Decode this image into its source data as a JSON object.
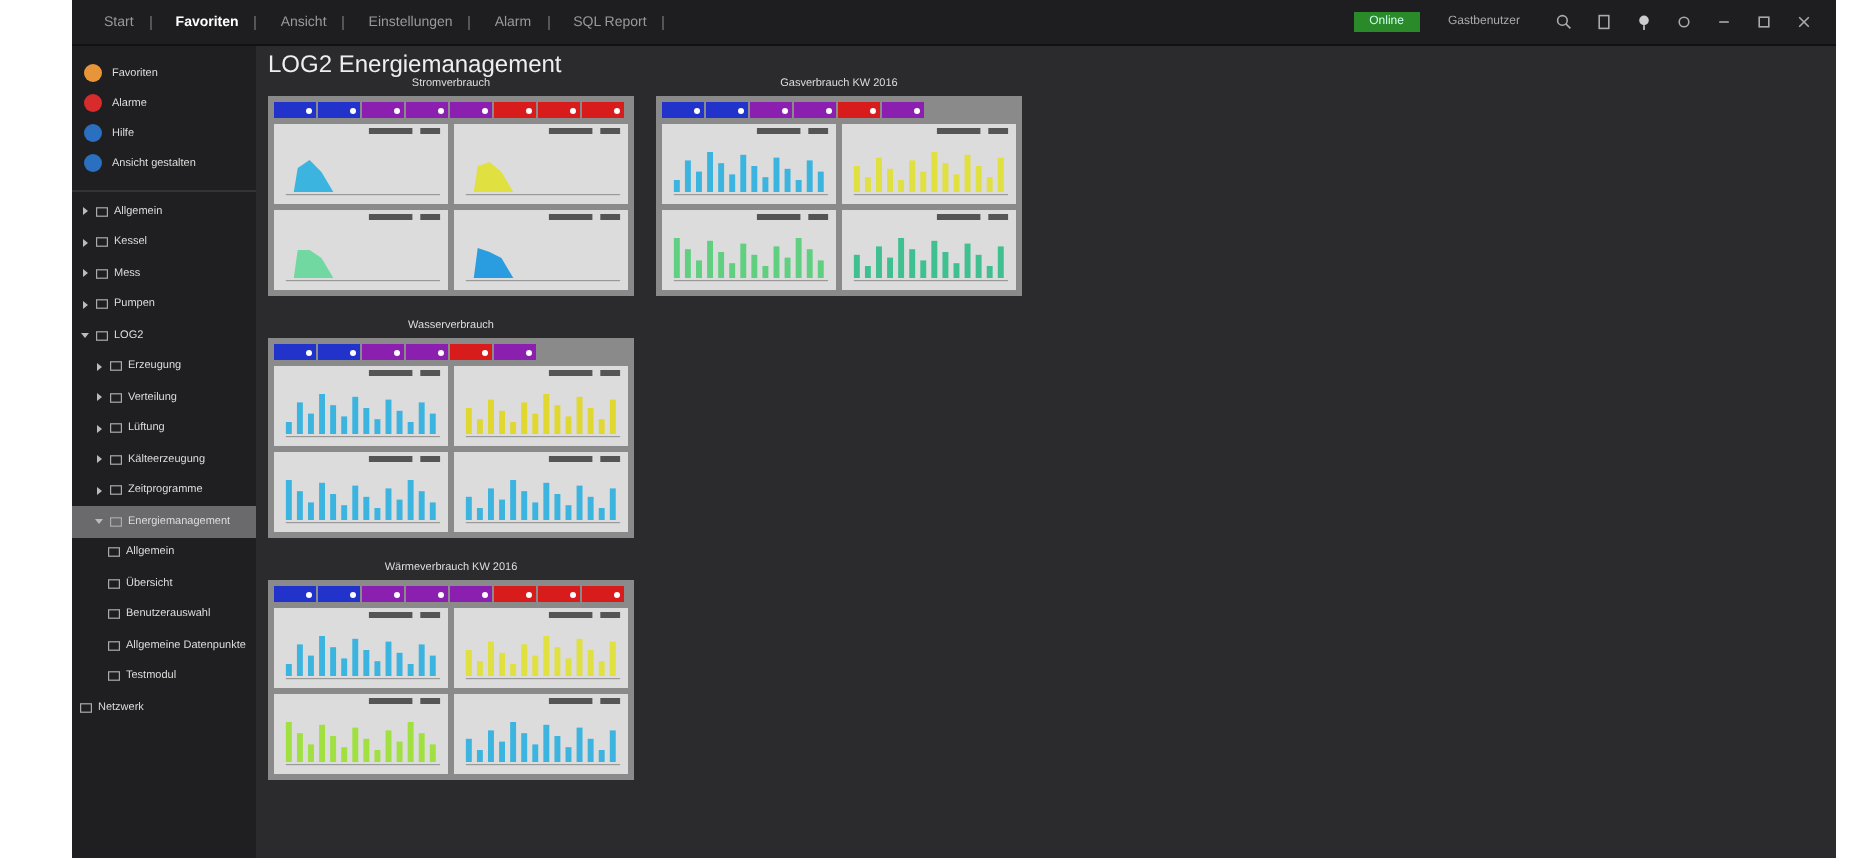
{
  "topbar": {
    "menu": [
      {
        "label": "Start",
        "selected": false
      },
      {
        "label": "Favoriten",
        "selected": true
      },
      {
        "label": "Ansicht",
        "selected": false
      },
      {
        "label": "Einstellungen",
        "selected": false
      },
      {
        "label": "Alarm",
        "selected": false
      },
      {
        "label": "SQL Report",
        "selected": false
      }
    ],
    "status": "Online",
    "user": "Gastbenutzer"
  },
  "sidebar": {
    "quick": [
      {
        "label": "Favoriten",
        "color": "#e8953a"
      },
      {
        "label": "Alarme",
        "color": "#d82b2b"
      },
      {
        "label": "Hilfe",
        "color": "#2a6fc0"
      },
      {
        "label": "Ansicht gestalten",
        "color": "#2a6fc0"
      }
    ],
    "tree": [
      {
        "label": "Allgemein",
        "expanded": false,
        "selected": false
      },
      {
        "label": "Kessel",
        "expanded": false,
        "selected": false
      },
      {
        "label": "Mess",
        "expanded": false,
        "selected": false
      },
      {
        "label": "Pumpen",
        "expanded": false,
        "selected": false
      },
      {
        "label": "LOG2",
        "expanded": true,
        "selected": false,
        "children": [
          {
            "label": "Erzeugung",
            "expanded": false,
            "selected": false
          },
          {
            "label": "Verteilung",
            "expanded": false,
            "selected": false
          },
          {
            "label": "Lüftung",
            "expanded": false,
            "selected": false
          },
          {
            "label": "Kälteerzeugung",
            "expanded": false,
            "selected": false
          },
          {
            "label": "Zeitprogramme",
            "expanded": false,
            "selected": false
          },
          {
            "label": "Energiemanagement",
            "expanded": true,
            "selected": true,
            "children": [
              {
                "label": "Allgemein",
                "selected": false
              },
              {
                "label": "Übersicht",
                "selected": false
              },
              {
                "label": "Benutzerauswahl",
                "selected": false
              },
              {
                "label": "Allgemeine Datenpunkte",
                "selected": false
              },
              {
                "label": "Testmodul",
                "selected": false
              }
            ]
          }
        ]
      },
      {
        "label": "Netzwerk",
        "selected": false
      }
    ]
  },
  "page": {
    "title": "LOG2 Energiemanagement",
    "panels": [
      {
        "title": "Stromverbrauch",
        "chips": [
          {
            "color": "#2233cc"
          },
          {
            "color": "#2233cc"
          },
          {
            "color": "#8a1fb0"
          },
          {
            "color": "#8a1fb0"
          },
          {
            "color": "#8a1fb0"
          },
          {
            "color": "#d81c1c"
          },
          {
            "color": "#d81c1c"
          },
          {
            "color": "#d81c1c"
          }
        ],
        "charts": [
          {
            "kind": "area",
            "color": "#3cb4e0"
          },
          {
            "kind": "area",
            "color": "#e0e040"
          },
          {
            "kind": "area",
            "color": "#70d8a0"
          },
          {
            "kind": "area",
            "color": "#2a9de0"
          }
        ]
      },
      {
        "title": "Wasserverbrauch",
        "chips": [
          {
            "color": "#2233cc"
          },
          {
            "color": "#2233cc"
          },
          {
            "color": "#8a1fb0"
          },
          {
            "color": "#8a1fb0"
          },
          {
            "color": "#d81c1c"
          },
          {
            "color": "#8a1fb0"
          }
        ],
        "charts": [
          {
            "kind": "bars",
            "color": "#3cb4e0"
          },
          {
            "kind": "bars",
            "color": "#e0d830"
          },
          {
            "kind": "bars",
            "color": "#3cb4e0"
          },
          {
            "kind": "bars",
            "color": "#3cb4e0"
          }
        ]
      },
      {
        "title": "Wärmeverbrauch KW 2016",
        "chips": [
          {
            "color": "#2233cc"
          },
          {
            "color": "#2233cc"
          },
          {
            "color": "#8a1fb0"
          },
          {
            "color": "#8a1fb0"
          },
          {
            "color": "#8a1fb0"
          },
          {
            "color": "#d81c1c"
          },
          {
            "color": "#d81c1c"
          },
          {
            "color": "#d81c1c"
          }
        ],
        "charts": [
          {
            "kind": "bars",
            "color": "#3cb4e0"
          },
          {
            "kind": "bars",
            "color": "#e0e040"
          },
          {
            "kind": "bars",
            "color": "#a0e040"
          },
          {
            "kind": "bars",
            "color": "#3cb4e0"
          }
        ]
      },
      {
        "title": "Gasverbrauch KW 2016",
        "chips": [
          {
            "color": "#2233cc"
          },
          {
            "color": "#2233cc"
          },
          {
            "color": "#8a1fb0"
          },
          {
            "color": "#8a1fb0"
          },
          {
            "color": "#d81c1c"
          },
          {
            "color": "#8a1fb0"
          }
        ],
        "charts": [
          {
            "kind": "bars",
            "color": "#3cb4e0"
          },
          {
            "kind": "bars",
            "color": "#e0e040"
          },
          {
            "kind": "bars",
            "color": "#60d080"
          },
          {
            "kind": "bars",
            "color": "#40c090"
          }
        ]
      }
    ]
  }
}
